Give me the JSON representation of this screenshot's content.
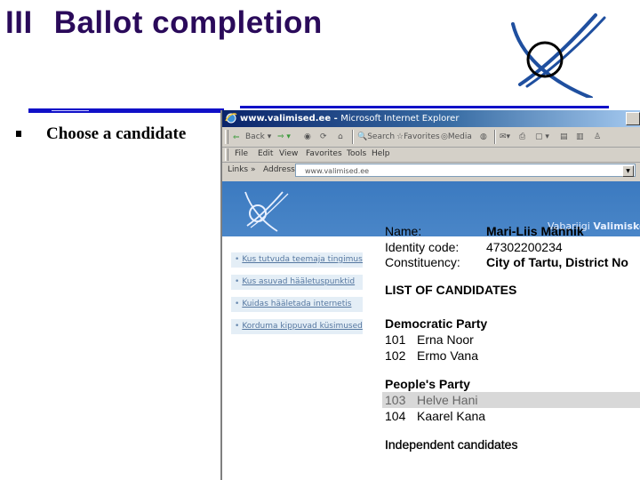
{
  "slide": {
    "section_number": "III",
    "title": "Ballot completion",
    "bullets": [
      "Choose a candidate"
    ]
  },
  "colors": {
    "title": "#2a0a5a",
    "rule": "#1010c8",
    "banner": "#4a86c8",
    "selected_row": "#d8d8d8"
  },
  "browser": {
    "window_title": "www.valimised.ee",
    "app_name": "Microsoft Internet Explorer",
    "toolbar": {
      "back": "Back",
      "search": "Search",
      "favorites": "Favorites",
      "media": "Media"
    },
    "menu": [
      "File",
      "Edit",
      "View",
      "Favorites",
      "Tools",
      "Help"
    ],
    "links_label": "Links »",
    "address_label": "Address",
    "address_value": "www.valimised.ee"
  },
  "site": {
    "banner_text_regular": "Vabariigi ",
    "banner_text_bold": "Valimiskon",
    "sidebar_links": [
      "Kus tutvuda teemaja tingimustega",
      "Kus asuvad hääletuspunktid",
      "Kuidas hääletada internetis",
      "Korduma kippuvad küsimused"
    ],
    "voter": {
      "name_label": "Name:",
      "name_value": "Mari-Liis Männik",
      "id_label": "Identity code:",
      "id_value": "47302200234",
      "constituency_label": "Constituency:",
      "constituency_value": "City of Tartu, District No"
    },
    "list_heading": "LIST OF CANDIDATES",
    "parties": [
      {
        "name": "Democratic Party",
        "candidates": [
          {
            "number": "101",
            "name": "Erna Noor",
            "selected": false
          },
          {
            "number": "102",
            "name": "Ermo Vana",
            "selected": false
          }
        ]
      },
      {
        "name": "People's Party",
        "candidates": [
          {
            "number": "103",
            "name": "Helve Hani",
            "selected": true
          },
          {
            "number": "104",
            "name": "Kaarel Kana",
            "selected": false
          }
        ]
      },
      {
        "name": "Independent candidates",
        "candidates": []
      }
    ]
  }
}
